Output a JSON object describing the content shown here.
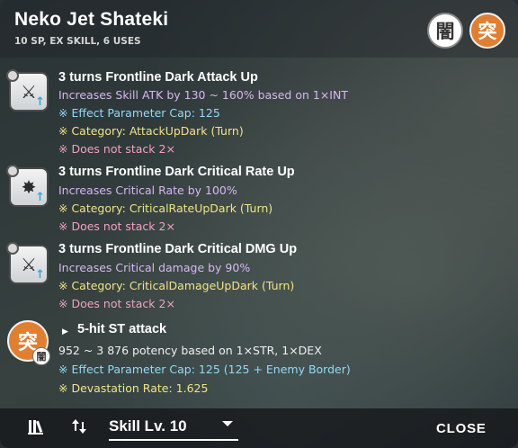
{
  "header": {
    "title": "Neko Jet Shateki",
    "subtitle": "10 SP, EX SKILL, 6 USES",
    "badge_dark": "闇",
    "badge_break": "突"
  },
  "effects": [
    {
      "title": "3 turns Frontline Dark Attack Up",
      "icon": "sword-attack-up-icon",
      "lines": [
        "Increases Skill ATK by 130 ~ 160% based on 1×INT",
        "※ Effect Parameter Cap: 125",
        "※ Category: AttackUpDark (Turn)",
        "※ Does not stack 2×"
      ]
    },
    {
      "title": "3 turns Frontline Dark Critical Rate Up",
      "icon": "critical-rate-up-icon",
      "lines": [
        "Increases Critical Rate by 100%",
        "※ Category: CriticalRateUpDark (Turn)",
        "※ Does not stack 2×"
      ]
    },
    {
      "title": "3 turns Frontline Dark Critical DMG Up",
      "icon": "critical-damage-up-icon",
      "lines": [
        "Increases Critical damage by 90%",
        "※ Category: CriticalDamageUpDark (Turn)",
        "※ Does not stack 2×"
      ]
    }
  ],
  "attack": {
    "title": "5-hit ST attack",
    "icon_main": "突",
    "icon_sub": "闇",
    "lines": [
      "952 ~ 3 876 potency based on 1×STR, 1×DEX",
      "※ Effect Parameter Cap: 125 (125 + Enemy Border)",
      "※ Devastation Rate: 1.625"
    ]
  },
  "footer": {
    "skill_level": "Skill Lv. 10",
    "close_label": "CLOSE"
  },
  "colors": {
    "break_badge": "#e07f32",
    "desc_text": "#d7b8f0",
    "cap_text": "#8fdcf5",
    "category_text": "#f2e38a",
    "stack_text": "#f0a2c0"
  }
}
